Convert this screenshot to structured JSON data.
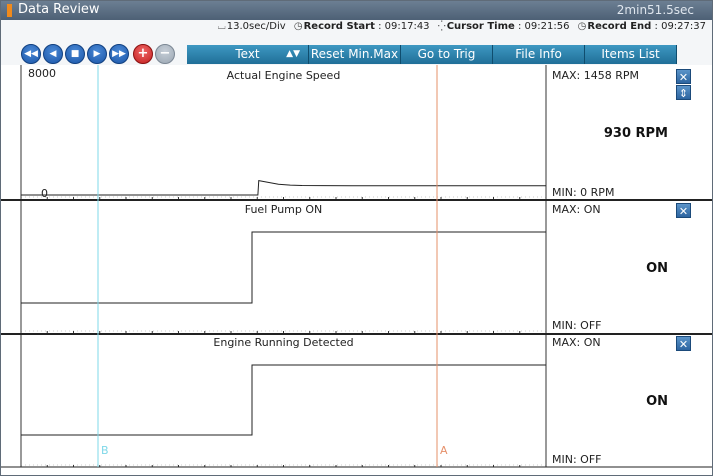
{
  "window": {
    "title": "Data Review",
    "elapsed": "2min51.5sec"
  },
  "info": {
    "div": "13.0sec/Div",
    "record_start_label": "Record Start",
    "record_start": ": 09:17:43",
    "cursor_time_label": "Cursor Time",
    "cursor_time": ": 09:21:56",
    "record_end_label": "Record End",
    "record_end": ": 09:27:37"
  },
  "toolbar": {
    "icons": [
      "rewind-icon",
      "step-back-icon",
      "stop-icon",
      "play-icon",
      "fast-forward-icon",
      "zoom-in-icon",
      "zoom-out-icon"
    ],
    "text_mode": "Text",
    "reset": "Reset Min.Max",
    "go_trig": "Go to Trig",
    "file_info": "File Info",
    "items_list": "Items List"
  },
  "panels": [
    {
      "title": "Actual Engine Speed",
      "ymax": "8000",
      "ymin": "0",
      "max": "MAX:  1458 RPM",
      "min": "MIN:     0 RPM",
      "value": "930 RPM"
    },
    {
      "title": "Fuel Pump ON",
      "max": "MAX: ON",
      "min": "MIN: OFF",
      "value": "ON"
    },
    {
      "title": "Engine Running Detected",
      "max": "MAX: ON",
      "min": "MIN: OFF",
      "value": "ON"
    }
  ],
  "cursors": {
    "b_label": "B",
    "a_label": "A",
    "b_color": "#7fd8e8",
    "a_color": "#e6906a"
  },
  "chart_data": [
    {
      "type": "line",
      "title": "Actual Engine Speed",
      "x_unit": "sec",
      "ylim": [
        0,
        8000
      ],
      "series": [
        {
          "x": [
            0,
            0.01,
            0.02,
            0.023,
            0.06,
            0.09,
            0.13,
            0.17,
            0.24,
            0.34,
            0.5,
            0.7,
            1.0
          ],
          "values": [
            0,
            0,
            0,
            1450,
            1250,
            1080,
            1000,
            960,
            945,
            935,
            932,
            930,
            930
          ]
        }
      ]
    },
    {
      "type": "line",
      "title": "Fuel Pump ON",
      "series": [
        {
          "x": [
            0,
            0.44,
            0.44,
            1.0
          ],
          "values": [
            0,
            0,
            1,
            1
          ]
        }
      ]
    },
    {
      "type": "line",
      "title": "Engine Running Detected",
      "series": [
        {
          "x": [
            0,
            0.44,
            0.44,
            1.0
          ],
          "values": [
            0,
            0,
            1,
            1
          ]
        }
      ]
    }
  ]
}
